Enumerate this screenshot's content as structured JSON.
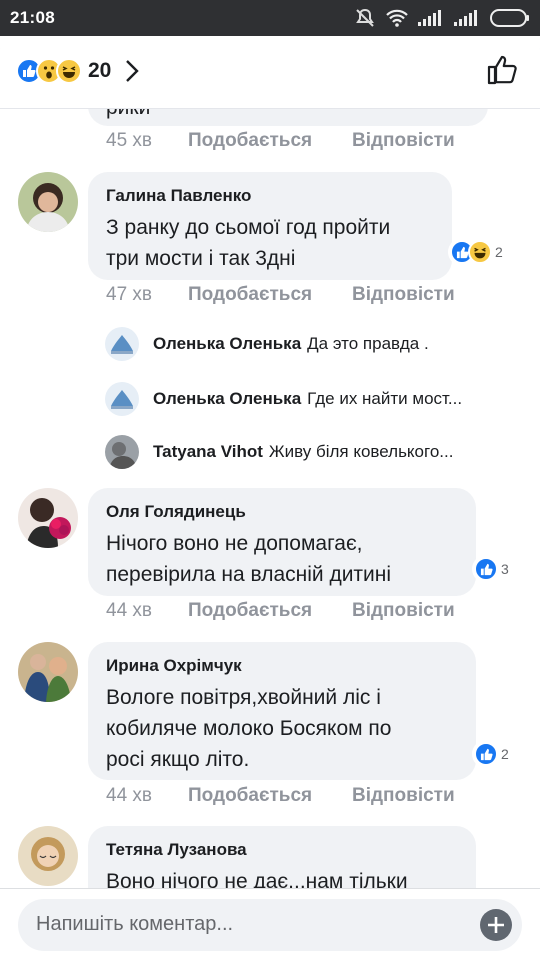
{
  "status_bar": {
    "time": "21:08"
  },
  "header": {
    "reaction_count": "20"
  },
  "comments": [
    {
      "id": "prev",
      "name": "",
      "text": "рики",
      "time": "45 хв"
    },
    {
      "id": "c1",
      "name": "Галина Павленко",
      "text": "З ранку до сьомої год пройти\nтри мости і так 3дні",
      "time": "47 хв",
      "reaction_count": "2"
    },
    {
      "id": "c2",
      "name": "Оля Голядинець",
      "text": "Нічого воно не допомагає,\nперевірила на власній дитині",
      "time": "44 хв",
      "reaction_count": "3"
    },
    {
      "id": "c3",
      "name": "Ирина Охрімчук",
      "text": "Вологе повітря,хвойний ліс і\nкобиляче молоко Босяком по\nросі якщо літо.",
      "time": "44 хв",
      "reaction_count": "2"
    },
    {
      "id": "c4",
      "name": "Тетяна Лузанова",
      "text": "Воно нічого не дає...нам тільки"
    }
  ],
  "replies": [
    {
      "name": "Оленька Оленька",
      "text": "Да это правда ."
    },
    {
      "name": "Оленька Оленька",
      "text": "Где их найти мост..."
    },
    {
      "name": "Tatyana  Vihot",
      "text": "Живу біля ковелького..."
    }
  ],
  "actions": {
    "like": "Подобається",
    "reply": "Відповісти"
  },
  "composer": {
    "placeholder": "Напишіть коментар..."
  },
  "colors": {
    "like_blue": "#1877f2",
    "emoji_yellow": "#f7c843",
    "bubble_gray": "#f0f2f5",
    "meta_gray": "#90949c",
    "status_bar": "#2f3033"
  }
}
